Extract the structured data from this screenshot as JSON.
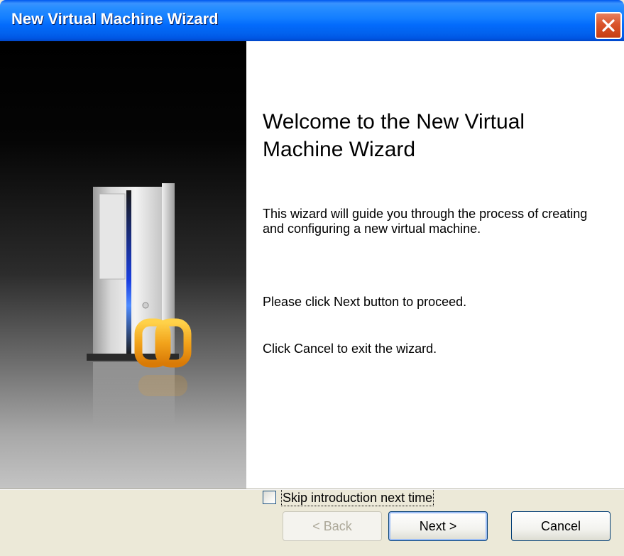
{
  "window": {
    "title": "New Virtual Machine Wizard",
    "close_icon": "close-icon"
  },
  "sidebar": {
    "illustration": "computer-tower-with-logo-icon",
    "logo_color": "#f2a31b"
  },
  "main": {
    "heading": "Welcome to the New Virtual Machine Wizard",
    "paragraphs": [
      "This wizard will guide you through the process of creating and configuring a new virtual machine.",
      "Please click Next button to proceed.",
      "Click Cancel to exit the wizard."
    ],
    "skip_checkbox": {
      "label": "Skip introduction next time",
      "checked": false
    }
  },
  "footer": {
    "back_label": "< Back",
    "next_label": "Next >",
    "cancel_label": "Cancel",
    "back_enabled": false
  },
  "colors": {
    "titlebar": "#0058ee",
    "close_button": "#d9542b",
    "dialog_background": "#ece9d8"
  }
}
